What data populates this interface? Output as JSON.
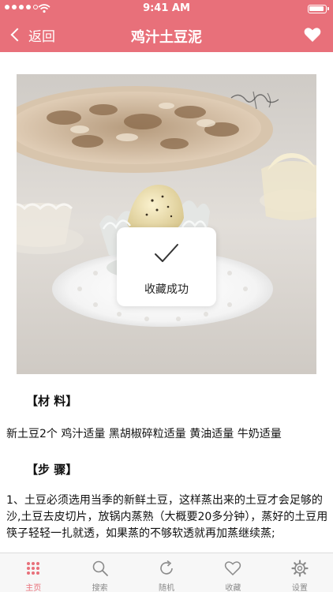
{
  "status_bar": {
    "time": "9:41 AM"
  },
  "nav": {
    "back_label": "返回",
    "title": "鸡汁土豆泥"
  },
  "toast": {
    "message": "收藏成功"
  },
  "content": {
    "materials_heading": "【材 料】",
    "materials_text": "新土豆2个 鸡汁适量 黑胡椒碎粒适量 黄油适量 牛奶适量",
    "steps_heading": "【步 骤】",
    "steps_text": "1、土豆必须选用当季的新鲜土豆，这样蒸出来的土豆才会足够的沙,土豆去皮切片，放锅内蒸熟（大概要20多分钟），蒸好的土豆用筷子轻轻一扎就透，如果蒸的不够软透就再加蒸继续蒸;"
  },
  "tabs": [
    {
      "label": "主页",
      "icon": "grid-icon",
      "active": true
    },
    {
      "label": "搜索",
      "icon": "search-icon",
      "active": false
    },
    {
      "label": "随机",
      "icon": "refresh-icon",
      "active": false
    },
    {
      "label": "收藏",
      "icon": "heart-icon",
      "active": false
    },
    {
      "label": "设置",
      "icon": "gear-icon",
      "active": false
    }
  ],
  "colors": {
    "accent": "#e8707a",
    "tab_inactive": "#8a8a8a"
  }
}
